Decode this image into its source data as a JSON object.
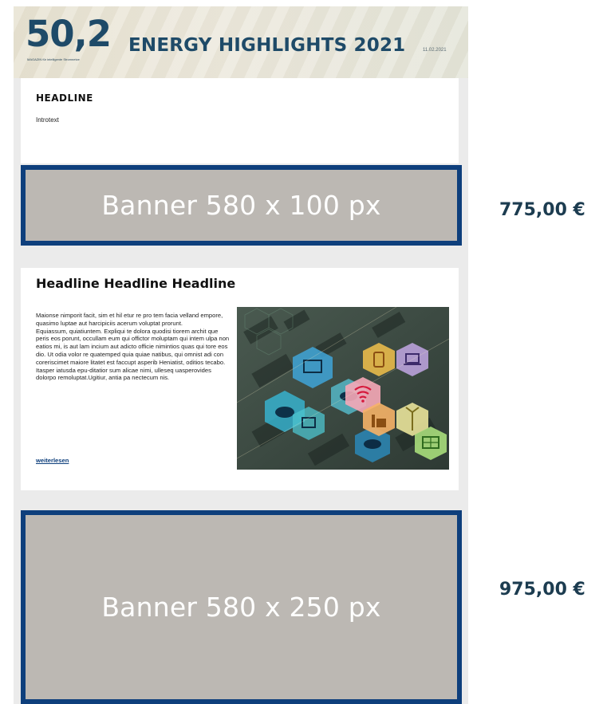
{
  "masthead": {
    "logo_number": "50,2",
    "logo_tagline": "MAGAZIN für intelligente Stromnetze",
    "title": "ENERGY HIGHLIGHTS 2021",
    "date": "11.02.2021"
  },
  "intro": {
    "headline": "HEADLINE",
    "text": "Introtext"
  },
  "banners": [
    {
      "label": "Banner 580 x 100 px",
      "price": "775,00 €"
    },
    {
      "label": "Banner 580 x 250 px",
      "price": "975,00 €"
    }
  ],
  "article": {
    "title": "Headline Headline Headline",
    "paragraph_1": "Maionse nimporit facit, sim et hil etur re pro tem facia velland empore, quasimo luptae aut harcipiciis acerum voluptat prorunt.",
    "paragraph_2": "Equiassum, quiatiuntem. Expliqui te dolora quodisi tiorem archit que peris eos porunt, occullam eum qui offictor moluptam qui intem ulpa non eatios mi, is aut lam incium aut adicto officie nimintios quas qui tore eos dio. Ut odia volor re quatemped quia quiae natibus, qui omnist adi con coreriscimet maiore litatet est faccupt asperib Heniatist, oditios tecabo. Itasper iatusda epu-ditatior sum alicae nimi, ulleseq uasperovides dolorpo remoluptat.Ugitiur, antia pa nectecum nis.",
    "read_more": "weiterlesen",
    "image_icons": [
      "monitor-icon",
      "tablet-icon",
      "laptop-icon",
      "wifi-icon",
      "factory-icon",
      "wind-turbine-icon",
      "solar-panel-icon",
      "cloud-icon"
    ]
  },
  "colors": {
    "banner_border": "#0e3f7c",
    "banner_fill": "#bcb8b3",
    "price_text": "#1c3c50",
    "link": "#0e3f7c"
  }
}
